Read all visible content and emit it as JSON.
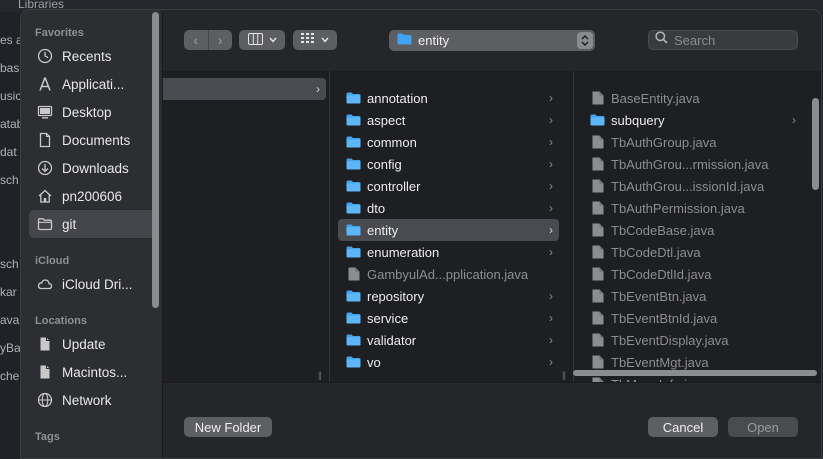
{
  "background": {
    "top_label": "Libraries",
    "left_fragments": [
      "es a",
      "bas",
      "usic",
      "atab",
      "dat",
      "sch",
      "",
      "",
      "sch",
      "kar",
      "ava",
      "yBa",
      "che"
    ]
  },
  "sidebar": {
    "favorites_label": "Favorites",
    "favorites": [
      {
        "label": "Recents",
        "icon": "clock-icon"
      },
      {
        "label": "Applicati...",
        "icon": "applications-icon"
      },
      {
        "label": "Desktop",
        "icon": "desktop-icon"
      },
      {
        "label": "Documents",
        "icon": "document-icon"
      },
      {
        "label": "Downloads",
        "icon": "download-icon"
      },
      {
        "label": "pn200606",
        "icon": "home-icon"
      },
      {
        "label": "git",
        "icon": "folder-icon",
        "selected": true
      }
    ],
    "icloud_label": "iCloud",
    "icloud": [
      {
        "label": "iCloud Dri...",
        "icon": "cloud-icon"
      }
    ],
    "locations_label": "Locations",
    "locations": [
      {
        "label": "Update",
        "icon": "disk-icon"
      },
      {
        "label": "Macintos...",
        "icon": "disk-icon"
      },
      {
        "label": "Network",
        "icon": "globe-icon"
      }
    ],
    "tags_label": "Tags"
  },
  "toolbar": {
    "back_glyph": "‹",
    "forward_glyph": "›",
    "path_folder": "entity",
    "search_placeholder": "Search"
  },
  "columns": {
    "col2": [
      {
        "label": "annotation",
        "type": "folder"
      },
      {
        "label": "aspect",
        "type": "folder"
      },
      {
        "label": "common",
        "type": "folder"
      },
      {
        "label": "config",
        "type": "folder"
      },
      {
        "label": "controller",
        "type": "folder"
      },
      {
        "label": "dto",
        "type": "folder"
      },
      {
        "label": "entity",
        "type": "folder",
        "selected": true
      },
      {
        "label": "enumeration",
        "type": "folder"
      },
      {
        "label": "GambyulAd...pplication.java",
        "type": "file"
      },
      {
        "label": "repository",
        "type": "folder"
      },
      {
        "label": "service",
        "type": "folder"
      },
      {
        "label": "validator",
        "type": "folder"
      },
      {
        "label": "vo",
        "type": "folder"
      }
    ],
    "col3": [
      {
        "label": "BaseEntity.java",
        "type": "file"
      },
      {
        "label": "subquery",
        "type": "folder"
      },
      {
        "label": "TbAuthGroup.java",
        "type": "file"
      },
      {
        "label": "TbAuthGrou...rmission.java",
        "type": "file"
      },
      {
        "label": "TbAuthGrou...issionId.java",
        "type": "file"
      },
      {
        "label": "TbAuthPermission.java",
        "type": "file"
      },
      {
        "label": "TbCodeBase.java",
        "type": "file"
      },
      {
        "label": "TbCodeDtl.java",
        "type": "file"
      },
      {
        "label": "TbCodeDtlId.java",
        "type": "file"
      },
      {
        "label": "TbEventBtn.java",
        "type": "file"
      },
      {
        "label": "TbEventBtnId.java",
        "type": "file"
      },
      {
        "label": "TbEventDisplay.java",
        "type": "file"
      },
      {
        "label": "TbEventMgt.java",
        "type": "file"
      },
      {
        "label": "TbMenuInfo.java",
        "type": "file"
      }
    ]
  },
  "footer": {
    "new_folder": "New Folder",
    "cancel": "Cancel",
    "open": "Open"
  },
  "colors": {
    "folder_blue": "#3fa3f2",
    "selection": "#4a4b50",
    "sidebar_bg": "#2d2e32"
  }
}
